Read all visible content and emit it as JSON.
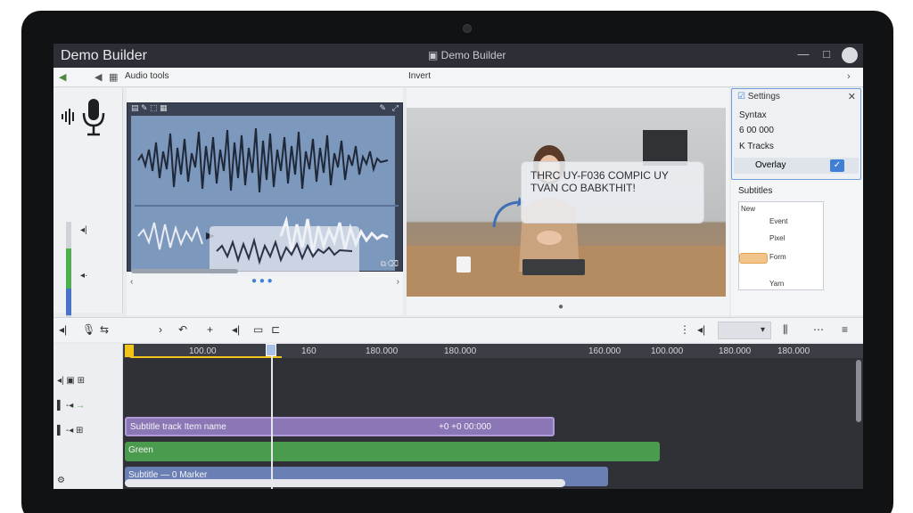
{
  "window": {
    "app_title": "Demo Builder",
    "center_title": "Demo Builder",
    "controls": [
      "—",
      "□",
      "✕"
    ]
  },
  "toolbar": {
    "back_icon": "arrow-left-icon",
    "forward_icon": "arrow-right-icon",
    "grid_icon": "grid-icon",
    "audio_tab": "Audio tools",
    "video_tab": "Invert"
  },
  "waveform": {
    "tools": "▤ ✎ ⬚ ▦"
  },
  "video": {
    "caption": "THRC UY-F036 COMPIC UY TVAN CO BABKTHIT!"
  },
  "settings": {
    "title": "Settings",
    "items": [
      "Syntax",
      "6 00 000",
      "K Tracks",
      "Overlay"
    ],
    "subtitles_title": "Subtitles",
    "list_items": [
      "New",
      "Event",
      "Pixel",
      "Form",
      "Yarn"
    ]
  },
  "timeline": {
    "ruler_ticks": [
      "100.00",
      "160",
      "180.000",
      "180.000",
      "160.000",
      "100.000",
      "180.000",
      "180.000"
    ],
    "clips": {
      "purple": "Subtitle track    Item name",
      "purple_markers": "+0    +0    00:000",
      "green": "Green",
      "blue": "Subtitle — 0 Marker"
    }
  },
  "colors": {
    "accent": "#3f7fd6",
    "clip_purple": "#8c77b6",
    "clip_green": "#4b9b4f",
    "clip_blue": "#6a7fb4"
  }
}
